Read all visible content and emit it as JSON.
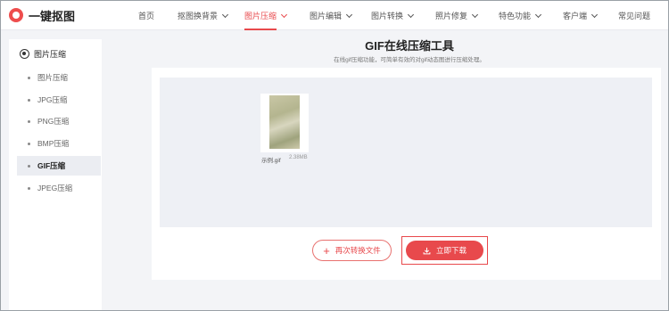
{
  "header": {
    "logo_text": "一键抠图",
    "nav": [
      {
        "label": "首页",
        "dropdown": false,
        "active": false
      },
      {
        "label": "抠图换背景",
        "dropdown": true,
        "active": false
      },
      {
        "label": "图片压缩",
        "dropdown": true,
        "active": true
      },
      {
        "label": "图片编辑",
        "dropdown": true,
        "active": false
      },
      {
        "label": "图片转换",
        "dropdown": true,
        "active": false
      },
      {
        "label": "照片修复",
        "dropdown": true,
        "active": false
      },
      {
        "label": "特色功能",
        "dropdown": true,
        "active": false
      },
      {
        "label": "客户端",
        "dropdown": true,
        "active": false
      },
      {
        "label": "常见问题",
        "dropdown": false,
        "active": false
      }
    ]
  },
  "sidebar": {
    "heading": "图片压缩",
    "items": [
      {
        "label": "图片压缩",
        "active": false
      },
      {
        "label": "JPG压缩",
        "active": false
      },
      {
        "label": "PNG压缩",
        "active": false
      },
      {
        "label": "BMP压缩",
        "active": false
      },
      {
        "label": "GIF压缩",
        "active": true
      },
      {
        "label": "JPEG压缩",
        "active": false
      }
    ]
  },
  "main": {
    "title": "GIF在线压缩工具",
    "subtitle": "在线gif压缩功能，可简单有效的对gif动态图进行压缩处理。",
    "file": {
      "name": "示例.gif",
      "size": "2.38MB"
    },
    "again_button": "再次转换文件",
    "download_button": "立即下载"
  },
  "colors": {
    "accent": "#e8494c",
    "page_bg": "#f3f4f7",
    "drop_bg": "#eef0f5"
  },
  "icons": {
    "logo": "logo-icon",
    "sidebar_heading": "target-icon",
    "again": "plus-icon",
    "download": "download-icon"
  }
}
